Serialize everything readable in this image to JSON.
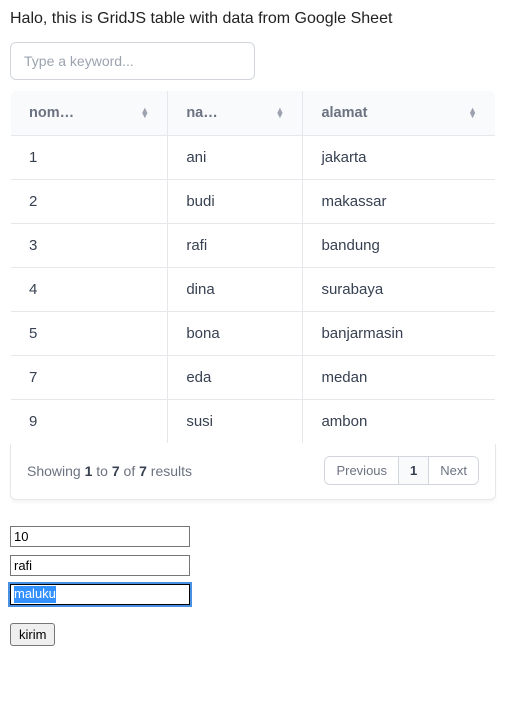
{
  "heading": "Halo, this is GridJS table with data from Google Sheet",
  "search": {
    "placeholder": "Type a keyword..."
  },
  "columns": [
    {
      "label": "nom…"
    },
    {
      "label": "na…"
    },
    {
      "label": "alamat"
    }
  ],
  "rows": [
    {
      "nomor": "1",
      "nama": "ani",
      "alamat": "jakarta"
    },
    {
      "nomor": "2",
      "nama": "budi",
      "alamat": "makassar"
    },
    {
      "nomor": "3",
      "nama": "rafi",
      "alamat": "bandung"
    },
    {
      "nomor": "4",
      "nama": "dina",
      "alamat": "surabaya"
    },
    {
      "nomor": "5",
      "nama": "bona",
      "alamat": "banjarmasin"
    },
    {
      "nomor": "7",
      "nama": "eda",
      "alamat": "medan"
    },
    {
      "nomor": "9",
      "nama": "susi",
      "alamat": "ambon"
    }
  ],
  "summary": {
    "prefix": "Showing ",
    "from": "1",
    "to_word": " to ",
    "to": "7",
    "of_word": " of ",
    "total": "7",
    "suffix": " results"
  },
  "pagination": {
    "prev": "Previous",
    "page": "1",
    "next": "Next"
  },
  "form": {
    "field1": "10",
    "field2": "rafi",
    "field3": "maluku",
    "submit": "kirim"
  }
}
